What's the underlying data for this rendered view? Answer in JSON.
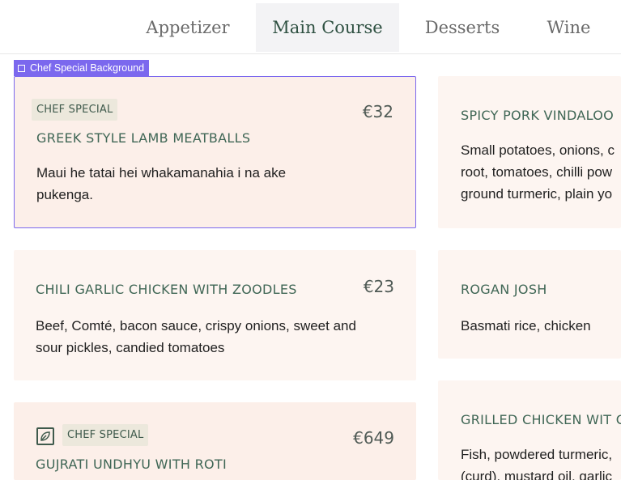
{
  "tabs": [
    {
      "label": "Appetizer"
    },
    {
      "label": "Main Course"
    },
    {
      "label": "Desserts"
    },
    {
      "label": "Wine"
    }
  ],
  "selection_label": "Chef Special Background",
  "cards": {
    "lamb": {
      "badge": "CHEF SPECIAL",
      "price": "€32",
      "title": "GREEK STYLE LAMB MEATBALLS",
      "desc": "Maui he tatai hei whakamanahia i na ake pukenga."
    },
    "vindaloo": {
      "title": "SPICY PORK VINDALOO",
      "desc": "Small potatoes, onions, c root, tomatoes, chilli pow ground turmeric, plain yo"
    },
    "chili": {
      "price": "€23",
      "title": "CHILI GARLIC CHICKEN WITH ZOODLES",
      "desc": "Beef, Comté, bacon sauce, crispy onions, sweet and sour pickles, candied tomatoes"
    },
    "rogan": {
      "title": "ROGAN JOSH",
      "desc": "Basmati rice, chicken"
    },
    "gujrati": {
      "badge": "CHEF SPECIAL",
      "price": "€649",
      "title": "GUJRATI UNDHYU WITH ROTI",
      "icon": "leaf-icon"
    },
    "grilled": {
      "title": "GRILLED CHICKEN WIT C",
      "desc": "Fish, powdered turmeric, (curd), mustard oil, garlic"
    }
  }
}
